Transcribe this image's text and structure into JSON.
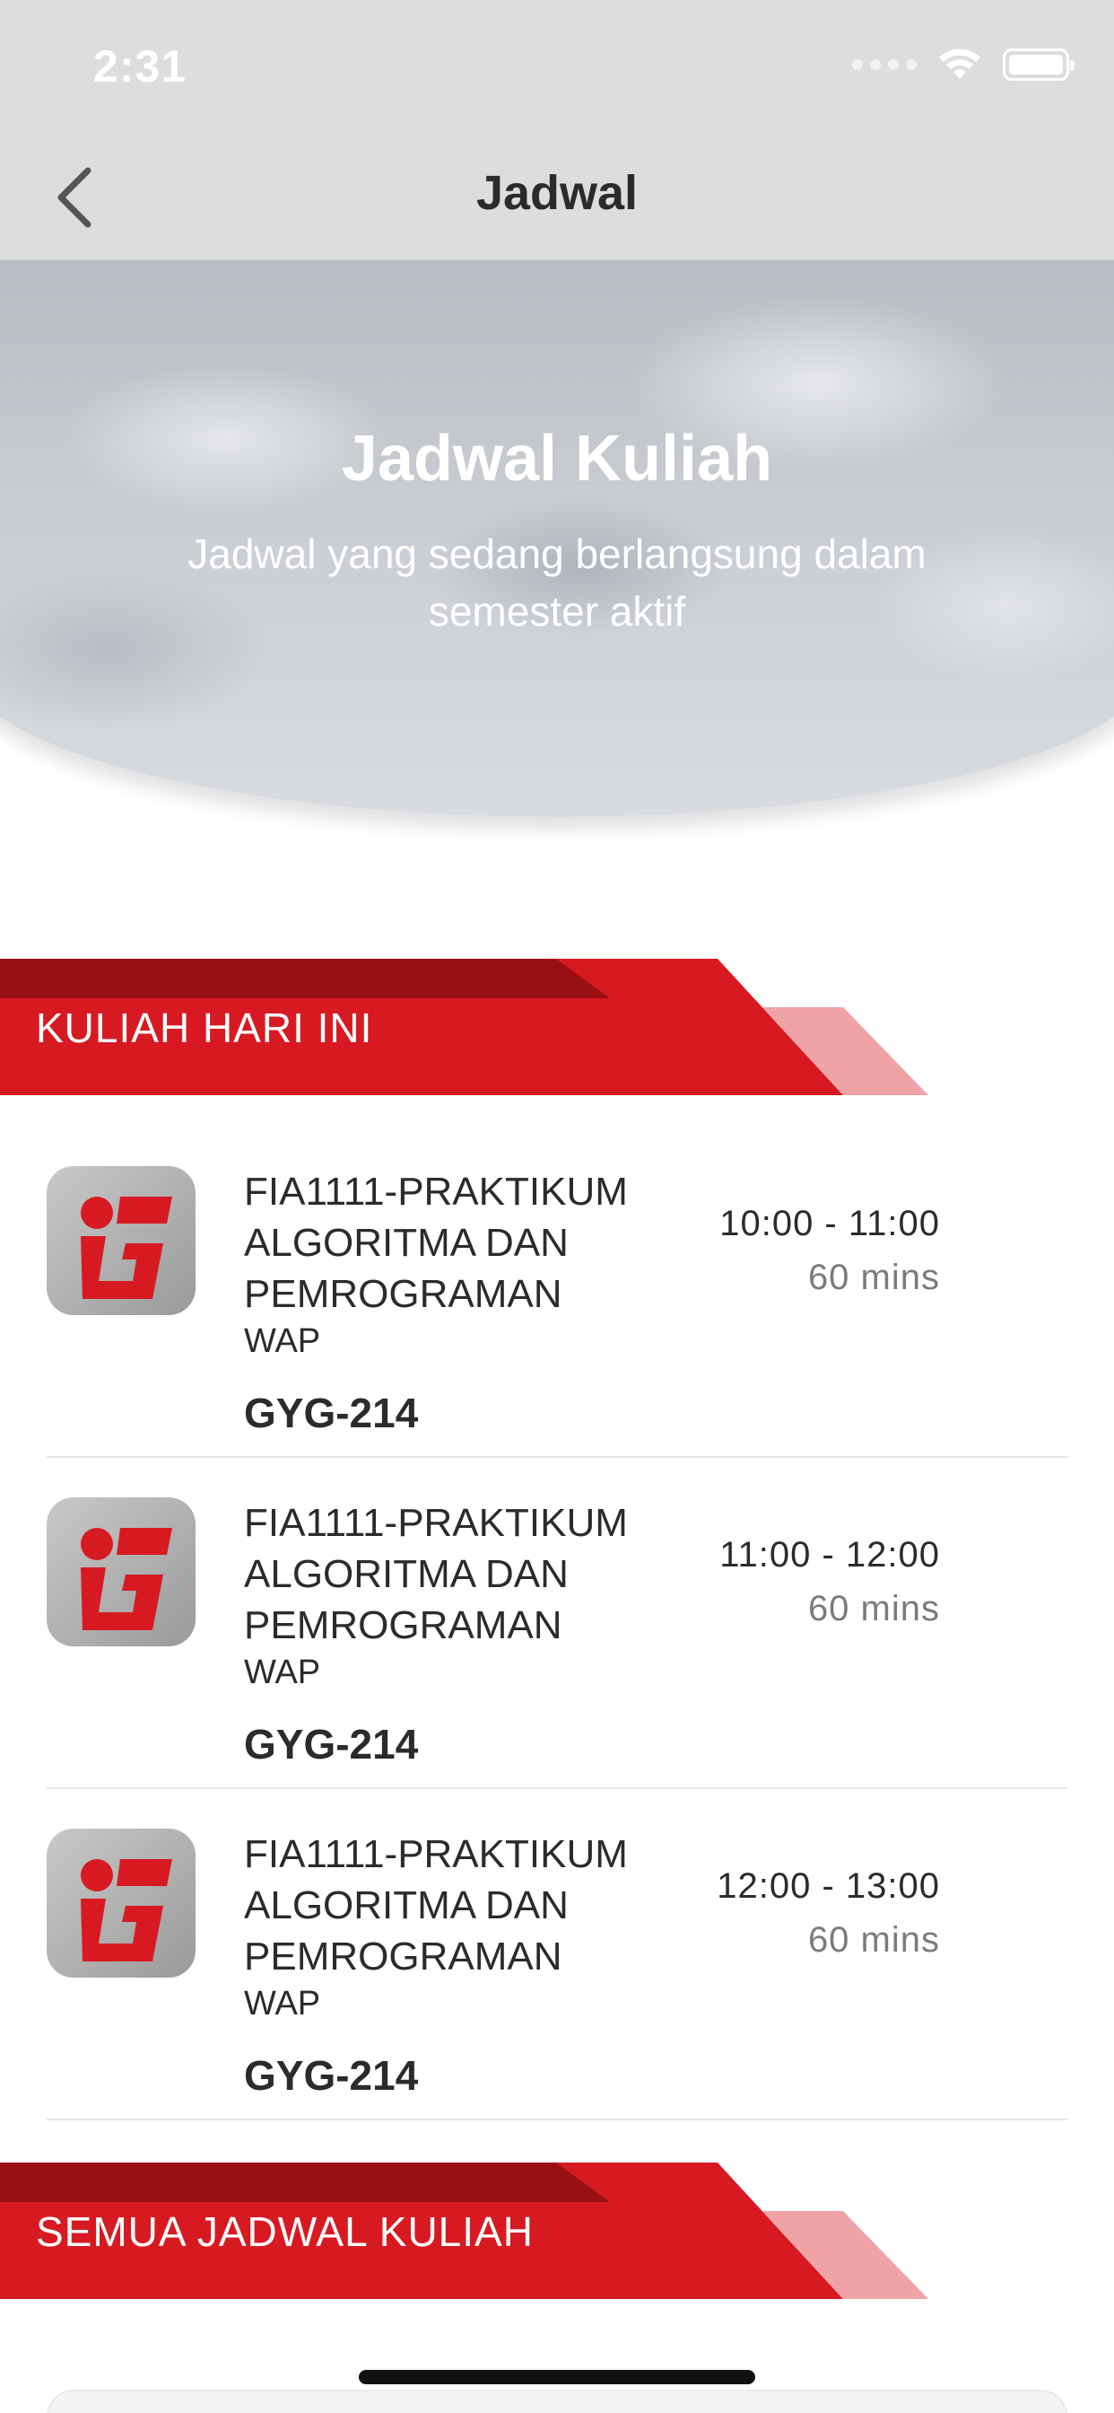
{
  "status_bar": {
    "time": "2:31",
    "icons": [
      "signal-dots-icon",
      "wifi-icon",
      "battery-icon"
    ]
  },
  "nav": {
    "back_icon": "chevron-left-icon",
    "title": "Jadwal"
  },
  "hero": {
    "title": "Jadwal Kuliah",
    "subtitle": "Jadwal yang sedang berlangsung dalam semester aktif"
  },
  "colors": {
    "banner_red": "#d71a22",
    "banner_dark_red": "#9a0f16",
    "banner_light_red": "#f0a3a6",
    "nav_bg": "#dddddd",
    "text_dark": "#2b2b2b",
    "text_muted": "#7b7b7b"
  },
  "sections": {
    "today": {
      "label": "KULIAH HARI INI"
    },
    "all": {
      "label": "SEMUA JADWAL KULIAH"
    }
  },
  "schedule": [
    {
      "icon": "app-logo-icon",
      "course": "FIA1111-PRAKTIKUM ALGORITMA DAN PEMROGRAMAN",
      "class": "WAP",
      "room": "GYG-214",
      "time": "10:00 - 11:00",
      "duration": "60 mins"
    },
    {
      "icon": "app-logo-icon",
      "course": "FIA1111-PRAKTIKUM ALGORITMA DAN PEMROGRAMAN",
      "class": "WAP",
      "room": "GYG-214",
      "time": "11:00 - 12:00",
      "duration": "60 mins"
    },
    {
      "icon": "app-logo-icon",
      "course": "FIA1111-PRAKTIKUM ALGORITMA DAN PEMROGRAMAN",
      "class": "WAP",
      "room": "GYG-214",
      "time": "12:00 - 13:00",
      "duration": "60 mins"
    }
  ]
}
